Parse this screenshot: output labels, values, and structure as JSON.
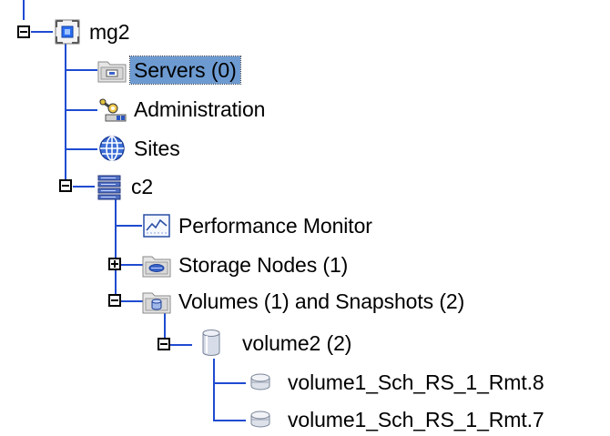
{
  "tree": {
    "root": {
      "label": "mg2",
      "icon": "management-group-icon",
      "expanded": true
    },
    "servers": {
      "label": "Servers (0)",
      "icon": "servers-folder-icon",
      "selected": true
    },
    "administration": {
      "label": "Administration",
      "icon": "administration-icon"
    },
    "sites": {
      "label": "Sites",
      "icon": "globe-icon"
    },
    "cluster": {
      "label": "c2",
      "icon": "cluster-icon",
      "expanded": true
    },
    "performance": {
      "label": "Performance Monitor",
      "icon": "performance-monitor-icon"
    },
    "storage_nodes": {
      "label": "Storage Nodes (1)",
      "icon": "storage-nodes-folder-icon",
      "expanded": false
    },
    "volumes": {
      "label": "Volumes (1) and Snapshots (2)",
      "icon": "volumes-folder-icon",
      "expanded": true
    },
    "volume": {
      "label": "volume2 (2)",
      "icon": "volume-icon",
      "expanded": true
    },
    "snapshots": [
      {
        "label": "volume1_Sch_RS_1_Rmt.8",
        "icon": "snapshot-icon"
      },
      {
        "label": "volume1_Sch_RS_1_Rmt.7",
        "icon": "snapshot-icon"
      }
    ]
  },
  "colors": {
    "connector": "#1f4bd1",
    "selection": "#6d9bd1"
  }
}
